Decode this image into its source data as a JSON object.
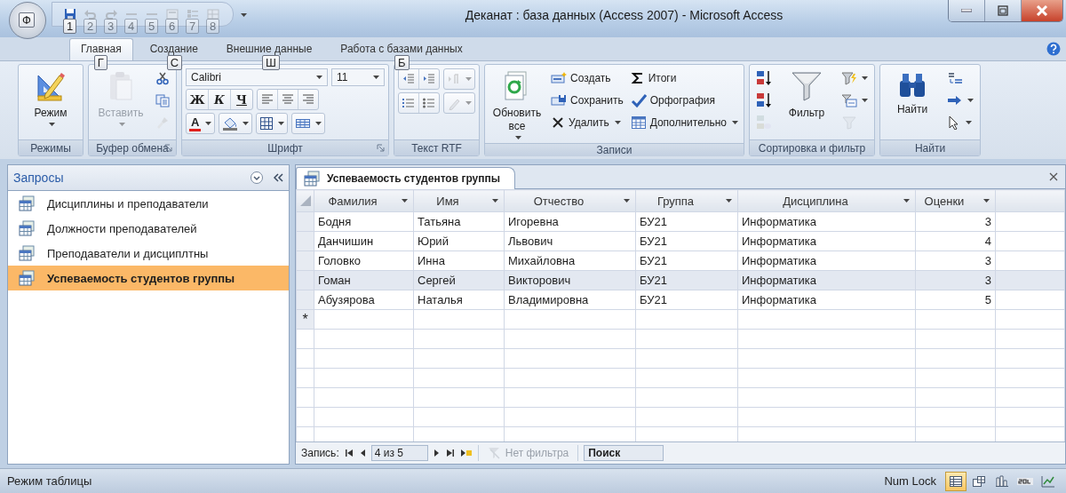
{
  "window": {
    "title": "Деканат : база данных (Access 2007) - Microsoft Access"
  },
  "office_button": {
    "keytip": "Ф"
  },
  "quick_access": [
    {
      "keytip": "1",
      "disabled": false
    },
    {
      "keytip": "2",
      "disabled": true
    },
    {
      "keytip": "3",
      "disabled": true
    },
    {
      "keytip": "4",
      "disabled": true
    },
    {
      "keytip": "5",
      "disabled": true
    },
    {
      "keytip": "6",
      "disabled": true
    },
    {
      "keytip": "7",
      "disabled": true
    },
    {
      "keytip": "8",
      "disabled": true
    }
  ],
  "tabs": [
    {
      "label": "Главная",
      "selected": true,
      "keytip": "Г"
    },
    {
      "label": "Создание",
      "selected": false,
      "keytip": "С"
    },
    {
      "label": "Внешние данные",
      "selected": false,
      "keytip": "Ш"
    },
    {
      "label": "Работа с базами данных",
      "selected": false,
      "keytip": "Б"
    }
  ],
  "ribbon_groups": [
    {
      "name": "Режимы",
      "launcher": false,
      "stacks": [
        [
          [
            {
              "kind": "large",
              "label": "Режим",
              "dropdown": true,
              "disabled": false
            }
          ]
        ]
      ]
    },
    {
      "name": "Буфер обмена",
      "launcher": true,
      "stacks": [
        [
          [
            {
              "kind": "large",
              "label": "Вставить",
              "dropdown": true,
              "disabled": true
            }
          ]
        ],
        [
          [
            {
              "kind": "icon",
              "disabled": false
            }
          ],
          [
            {
              "kind": "icon",
              "disabled": false
            }
          ],
          [
            {
              "kind": "icon",
              "disabled": true
            }
          ]
        ]
      ]
    },
    {
      "name": "Шрифт",
      "launcher": true,
      "stacks": [
        [
          [
            {
              "kind": "combo",
              "value": "Calibri",
              "wide": true
            },
            {
              "kind": "combo",
              "value": "11",
              "wide": false
            }
          ],
          [
            {
              "kind": "segment",
              "items": [
                {
                  "kind": "glyph",
                  "label": "Ж"
                },
                {
                  "kind": "glyph",
                  "label": "К"
                },
                {
                  "kind": "glyph",
                  "label": "Ч"
                }
              ]
            },
            {
              "kind": "segment",
              "items": [
                {
                  "kind": "icon",
                  "disabled": false
                },
                {
                  "kind": "icon",
                  "disabled": false
                },
                {
                  "kind": "icon",
                  "disabled": false
                }
              ]
            }
          ],
          [
            {
              "kind": "segment",
              "items": [
                {
                  "kind": "color-glyph",
                  "label": "A",
                  "dropdown": true
                }
              ]
            },
            {
              "kind": "segment",
              "items": [
                {
                  "kind": "icon",
                  "disabled": false,
                  "dropdown": true
                }
              ]
            },
            {
              "kind": "segment",
              "items": [
                {
                  "kind": "icon",
                  "disabled": false,
                  "dropdown": true
                }
              ]
            },
            {
              "kind": "segment",
              "items": [
                {
                  "kind": "icon",
                  "disabled": false,
                  "dropdown": true
                }
              ]
            }
          ]
        ]
      ]
    },
    {
      "name": "Текст RTF",
      "launcher": false,
      "stacks": [
        [
          [
            {
              "kind": "segment",
              "items": [
                {
                  "kind": "icon",
                  "disabled": false
                },
                {
                  "kind": "icon",
                  "disabled": false
                }
              ]
            },
            {
              "kind": "segment",
              "items": [
                {
                  "kind": "icon",
                  "disabled": true,
                  "dropdown": true
                }
              ]
            }
          ],
          [
            {
              "kind": "segment",
              "items": [
                {
                  "kind": "icon",
                  "disabled": false
                },
                {
                  "kind": "icon",
                  "disabled": false
                }
              ]
            },
            {
              "kind": "segment",
              "items": [
                {
                  "kind": "icon",
                  "disabled": true,
                  "dropdown": true
                }
              ]
            }
          ]
        ]
      ]
    },
    {
      "name": "Записи",
      "launcher": false,
      "stacks": [
        [
          [
            {
              "kind": "large",
              "label": "Обновить все",
              "dropdown": true,
              "disabled": false
            }
          ]
        ],
        [
          [
            {
              "kind": "small",
              "label": "Создать",
              "dropdown": false,
              "disabled": false
            }
          ],
          [
            {
              "kind": "small",
              "label": "Сохранить",
              "dropdown": false,
              "disabled": false
            }
          ],
          [
            {
              "kind": "small",
              "label": "Удалить",
              "dropdown": true,
              "disabled": false
            }
          ]
        ],
        [
          [
            {
              "kind": "small",
              "label": "Итоги",
              "dropdown": false,
              "disabled": false
            }
          ],
          [
            {
              "kind": "small",
              "label": "Орфография",
              "dropdown": false,
              "disabled": false
            }
          ],
          [
            {
              "kind": "small",
              "label": "Дополнительно",
              "dropdown": true,
              "disabled": false
            }
          ]
        ]
      ]
    },
    {
      "name": "Сортировка и фильтр",
      "launcher": false,
      "stacks": [
        [
          [
            {
              "kind": "icon",
              "disabled": false
            }
          ],
          [
            {
              "kind": "icon",
              "disabled": false
            }
          ],
          [
            {
              "kind": "icon",
              "disabled": true
            }
          ]
        ],
        [
          [
            {
              "kind": "large",
              "label": "Фильтр",
              "dropdown": false,
              "disabled": false
            }
          ]
        ],
        [
          [
            {
              "kind": "icon",
              "disabled": false,
              "dropdown": true
            }
          ],
          [
            {
              "kind": "icon",
              "disabled": false,
              "dropdown": true
            }
          ],
          [
            {
              "kind": "icon",
              "disabled": true
            }
          ]
        ]
      ]
    },
    {
      "name": "Найти",
      "launcher": false,
      "stacks": [
        [
          [
            {
              "kind": "large",
              "label": "Найти",
              "dropdown": false,
              "disabled": false
            }
          ]
        ],
        [
          [
            {
              "kind": "icon",
              "disabled": false
            }
          ],
          [
            {
              "kind": "icon",
              "disabled": false,
              "dropdown": true
            }
          ],
          [
            {
              "kind": "icon",
              "disabled": false,
              "dropdown": true
            }
          ]
        ]
      ]
    }
  ],
  "nav_pane": {
    "title": "Запросы",
    "items": [
      {
        "label": "Дисциплины и преподаватели",
        "selected": false
      },
      {
        "label": "Должности преподавателей",
        "selected": false
      },
      {
        "label": "Преподаватели и дисциплтны",
        "selected": false
      },
      {
        "label": "Успеваемость студентов группы",
        "selected": true
      }
    ]
  },
  "document_tab": {
    "title": "Успеваемость студентов группы"
  },
  "table": {
    "columns": [
      {
        "label": "Фамилия"
      },
      {
        "label": "Имя"
      },
      {
        "label": "Отчество"
      },
      {
        "label": "Группа"
      },
      {
        "label": "Дисциплина"
      },
      {
        "label": "Оценки"
      }
    ],
    "rows": [
      {
        "selected": false,
        "cells": [
          "Бодня",
          "Татьяна",
          "Игоревна",
          "БУ21",
          "Информатика",
          "3"
        ]
      },
      {
        "selected": false,
        "cells": [
          "Данчишин",
          "Юрий",
          "Львович",
          "БУ21",
          "Информатика",
          "4"
        ]
      },
      {
        "selected": false,
        "cells": [
          "Головко",
          "Инна",
          "Михайловна",
          "БУ21",
          "Информатика",
          "3"
        ]
      },
      {
        "selected": true,
        "cells": [
          "Гоман",
          "Сергей",
          "Викторович",
          "БУ21",
          "Информатика",
          "3"
        ]
      },
      {
        "selected": false,
        "cells": [
          "Абузярова",
          "Наталья",
          "Владимировна",
          "БУ21",
          "Информатика",
          "5"
        ]
      }
    ],
    "new_row_marker": "*"
  },
  "record_navigator": {
    "label": "Запись:",
    "position": "4 из 5",
    "filter": "Нет фильтра",
    "filter_disabled": true,
    "search": "Поиск"
  },
  "status_bar": {
    "text": "Режим таблицы",
    "num_lock": "Num Lock",
    "views": [
      {
        "selected": true
      },
      {
        "selected": false
      },
      {
        "selected": false
      },
      {
        "selected": false
      },
      {
        "selected": false
      }
    ]
  }
}
